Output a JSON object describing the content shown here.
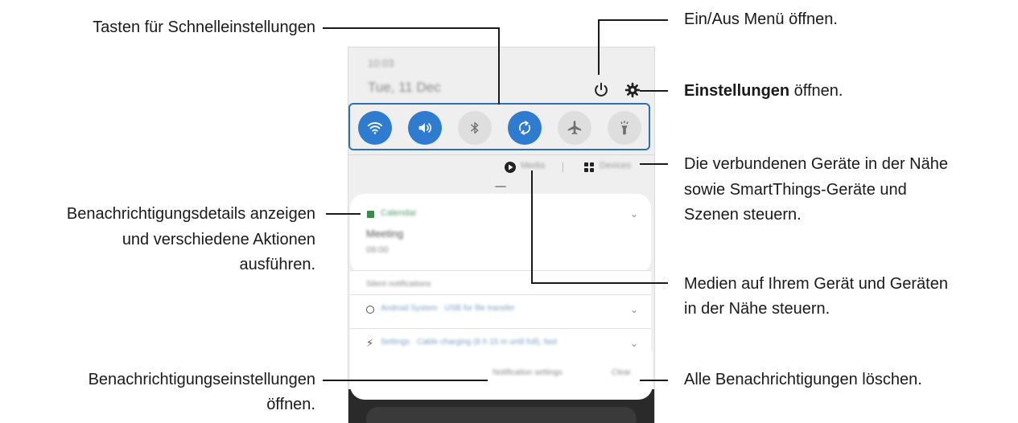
{
  "labels": {
    "quick_settings_buttons": "Tasten für Schnelleinstellungen",
    "notification_details_line1": "Benachrichtigungsdetails anzeigen",
    "notification_details_line2": "und verschiedene Aktionen",
    "notification_details_line3": "ausführen.",
    "notification_settings_line1": "Benachrichtigungseinstellungen",
    "notification_settings_line2": "öffnen.",
    "power_menu": "Ein/Aus Menü öffnen.",
    "settings_bold": "Einstellungen",
    "settings_rest": " öffnen.",
    "devices_line1": "Die verbundenen Geräte in der Nähe",
    "devices_line2": "sowie SmartThings-Geräte und",
    "devices_line3": "Szenen steuern.",
    "media_line1": "Medien auf Ihrem Gerät und Geräten",
    "media_line2": "in der Nähe steuern.",
    "clear_all": "Alle Benachrichtigungen löschen."
  },
  "phone": {
    "time": "10:03",
    "date": "Tue, 11 Dec",
    "media_label": "Media",
    "devices_label": "Devices",
    "notification_app": "Calendar",
    "notification_title": "Meeting",
    "notification_time": "09:00",
    "silent_header": "Silent notifications",
    "silent_1": "Android System · USB for file transfer",
    "silent_2": "Settings · Cable charging (8 h 15 m until full), fast",
    "notification_settings_button": "Notification settings",
    "clear_button": "Clear"
  },
  "quick_toggles": [
    {
      "name": "wifi",
      "active": true
    },
    {
      "name": "sound",
      "active": true
    },
    {
      "name": "bluetooth",
      "active": false
    },
    {
      "name": "auto-rotate",
      "active": true
    },
    {
      "name": "airplane-mode",
      "active": false
    },
    {
      "name": "flashlight",
      "active": false
    }
  ],
  "colors": {
    "accent": "#2e7bd0",
    "highlight_border": "#2e6fb7",
    "inactive_toggle": "#dedede"
  }
}
